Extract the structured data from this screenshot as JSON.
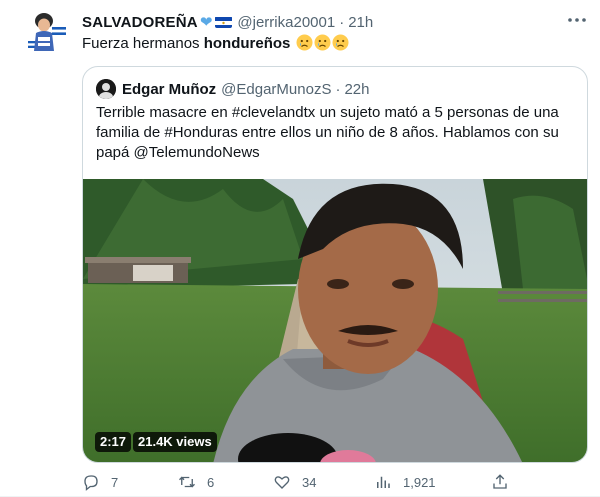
{
  "tweet": {
    "display_name": "SALVADOREÑA",
    "name_emoji": [
      "blue-heart",
      "el-salvador-flag"
    ],
    "handle": "@jerrika20001",
    "separator": "·",
    "time": "21h",
    "more_icon": "more-horizontal-icon",
    "text_prefix": "Fuerza hermanos ",
    "text_bold": "hondureños",
    "text_emoji": [
      "crying-face",
      "crying-face",
      "crying-face"
    ]
  },
  "quote": {
    "display_name": "Edgar Muñoz",
    "handle": "@EdgarMunozS",
    "separator": "·",
    "time": "22h",
    "text": "Terrible masacre en #clevelandtx un sujeto mató a 5 personas de una familia de #Honduras entre ellos un niño de 8 años. Hablamos con su papá @TelemundoNews",
    "video": {
      "duration": "2:17",
      "views": "21.4K views"
    }
  },
  "actions": {
    "reply_count": "7",
    "retweet_count": "6",
    "like_count": "34",
    "views_count": "1,921",
    "icons": [
      "reply-icon",
      "retweet-icon",
      "like-icon",
      "analytics-icon",
      "share-icon"
    ]
  },
  "colors": {
    "text": "#0f1419",
    "secondary": "#536471",
    "border": "#cfd9de",
    "heart": "#5aa9e6"
  }
}
